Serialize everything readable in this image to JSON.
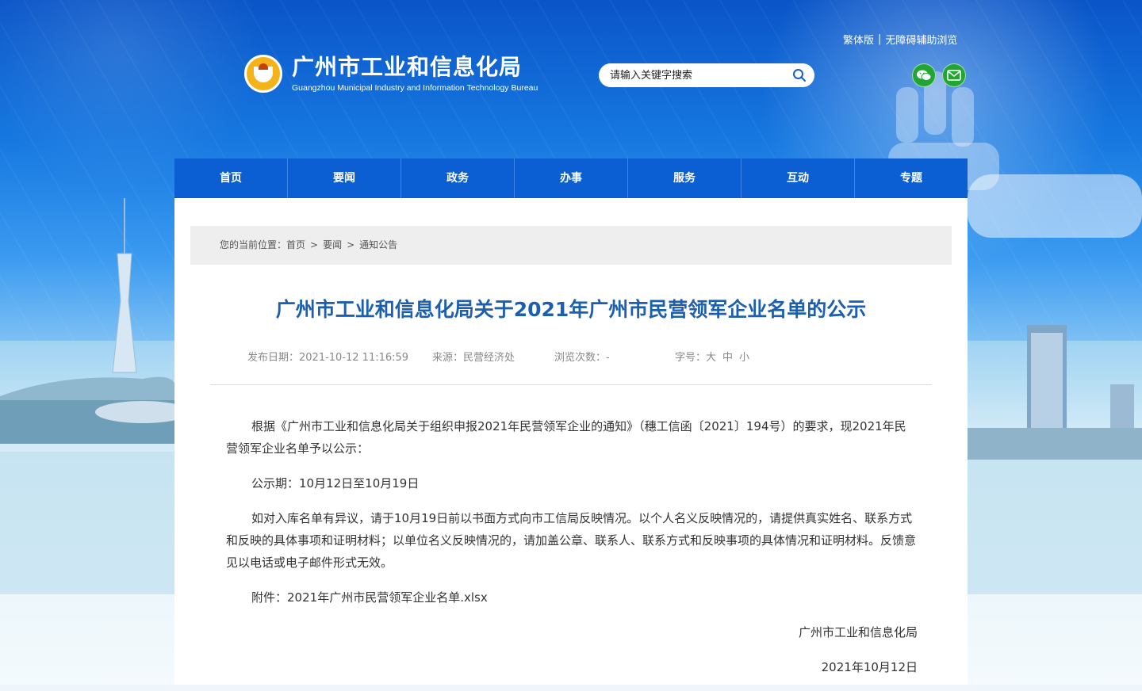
{
  "header": {
    "org_name_cn": "广州市工业和信息化局",
    "org_name_en": "Guangzhou Municipal Industry and Information Technology Bureau",
    "top_links": [
      "繁体版",
      "无障碍辅助浏览"
    ],
    "top_links_separator": "|",
    "search_placeholder": "请输入关键字搜索",
    "social_icons": [
      "wechat-icon",
      "mail-icon"
    ]
  },
  "nav": {
    "items": [
      "首页",
      "要闻",
      "政务",
      "办事",
      "服务",
      "互动",
      "专题"
    ]
  },
  "breadcrumb": {
    "prefix": "您的当前位置：",
    "items": [
      "首页",
      "要闻",
      "通知公告"
    ],
    "separator": ">"
  },
  "article": {
    "title": "广州市工业和信息化局关于2021年广州市民营领军企业名单的公示",
    "meta": {
      "publish": "发布日期：2021-10-12 11:16:59",
      "source": "来源：民营经济处",
      "views": "浏览次数：-",
      "font_size_label": "字号：",
      "font_sizes": [
        "大",
        "中",
        "小"
      ]
    },
    "paragraphs": [
      "根据《广州市工业和信息化局关于组织申报2021年民营领军企业的通知》（穗工信函〔2021〕194号）的要求，现2021年民营领军企业名单予以公示：",
      "公示期：10月12日至10月19日",
      "如对入库名单有异议，请于10月19日前以书面方式向市工信局反映情况。以个人名义反映情况的，请提供真实姓名、联系方式和反映的具体事项和证明材料；以单位名义反映情况的，请加盖公章、联系人、联系方式和反映事项的具体情况和证明材料。反馈意见以电话或电子邮件形式无效。"
    ],
    "attachment_label": "附件：",
    "attachment_file": "2021年广州市民营领军企业名单.xlsx",
    "signature": "广州市工业和信息化局",
    "date": "2021年10月12日"
  },
  "colors": {
    "nav_bg": "#0b5fd2",
    "title": "#1b5fae",
    "social_green": "#21a634"
  }
}
